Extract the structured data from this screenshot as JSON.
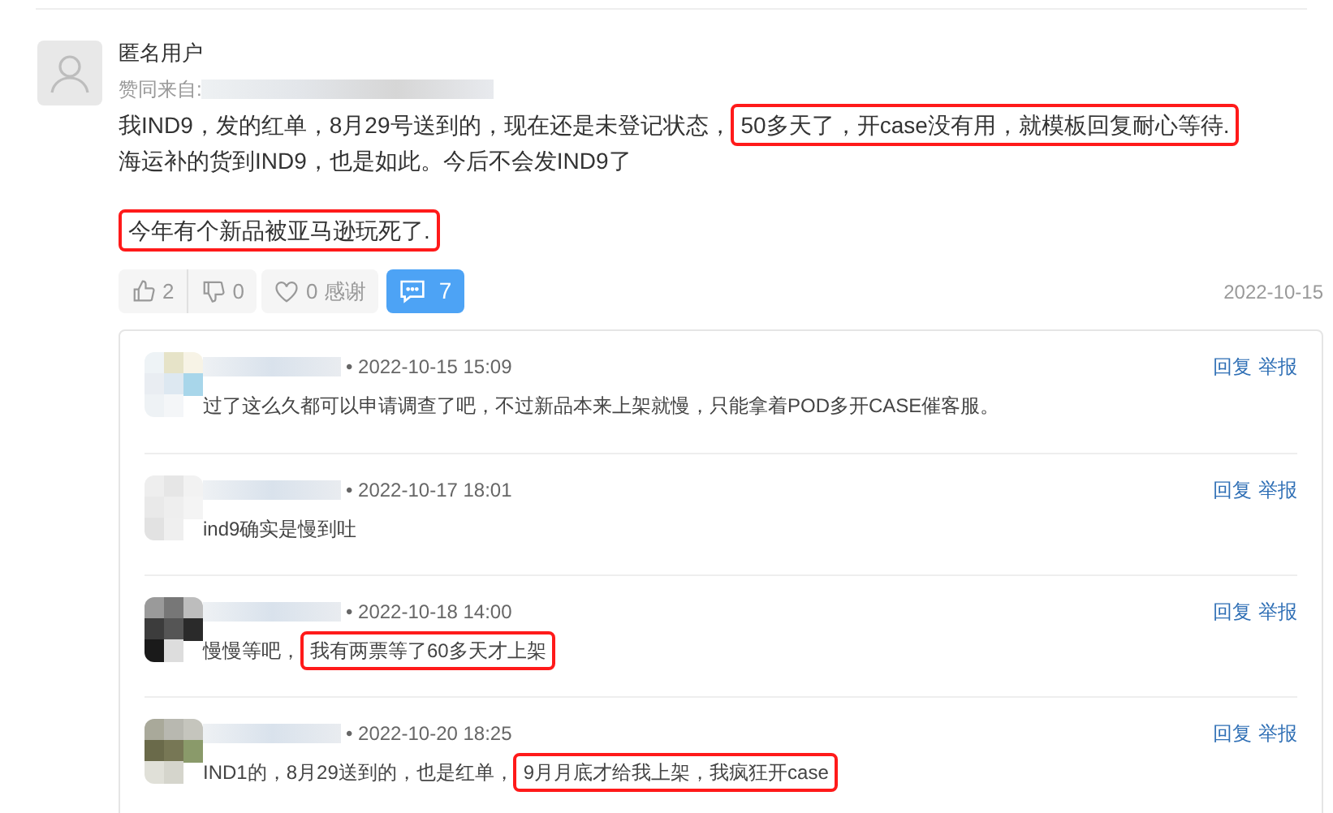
{
  "comment": {
    "author": "匿名用户",
    "upvoted_by_label": "赞同来自:",
    "paragraphs": [
      [
        {
          "text": "我IND9，发的红单，8月29号送到的，现在还是未登记状态，",
          "highlighted": false
        },
        {
          "text": "50多天了，开case没有用，就模板回复耐心等待.",
          "highlighted": true
        }
      ],
      [
        {
          "text": "海运补的货到IND9，也是如此。今后不会发IND9了",
          "highlighted": false
        }
      ],
      [
        {
          "text": "今年有个新品被亚马逊玩死了.",
          "highlighted": true
        }
      ]
    ],
    "actions": {
      "likes": "2",
      "dislikes": "0",
      "thanks": "0 感谢",
      "comments": "7"
    },
    "date": "2022-10-15"
  },
  "replies": [
    {
      "time": "• 2022-10-15 15:09",
      "segments": [
        {
          "text": "过了这么久都可以申请调查了吧，不过新品本来上架就慢，只能拿着POD多开CASE催客服。",
          "highlighted": false
        }
      ],
      "links": [
        "回复",
        "举报"
      ]
    },
    {
      "time": "• 2022-10-17 18:01",
      "segments": [
        {
          "text": "ind9确实是慢到吐",
          "highlighted": false
        }
      ],
      "links": [
        "回复",
        "举报"
      ]
    },
    {
      "time": "• 2022-10-18 14:00",
      "segments": [
        {
          "text": "慢慢等吧，",
          "highlighted": false
        },
        {
          "text": "我有两票等了60多天才上架",
          "highlighted": true
        }
      ],
      "links": [
        "回复",
        "举报"
      ]
    },
    {
      "time": "• 2022-10-20 18:25",
      "segments": [
        {
          "text": "IND1的，8月29送到的，也是红单，",
          "highlighted": false
        },
        {
          "text": "9月月底才给我上架，我疯狂开case",
          "highlighted": true
        }
      ],
      "links": [
        "回复",
        "举报"
      ]
    }
  ]
}
